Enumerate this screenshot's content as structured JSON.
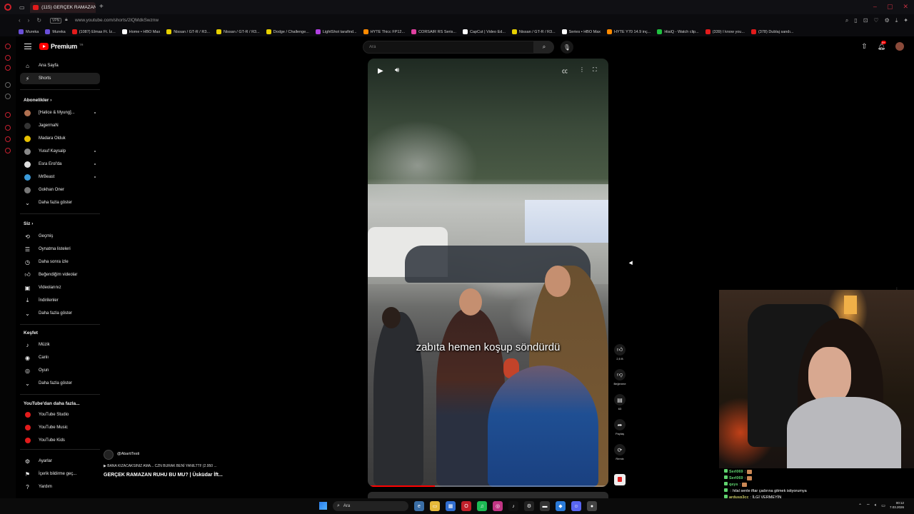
{
  "browser": {
    "tab_title": "(115) GERÇEK RAMAZAN R",
    "url": "www.youtube.com/shorts/2lQMdkSwznw",
    "vpn_label": "VPN",
    "bookmarks": [
      {
        "label": "Mureka",
        "color": "#6a4fd8"
      },
      {
        "label": "Mureka",
        "color": "#6a4fd8"
      },
      {
        "label": "(1087) Elmas Ft. İz...",
        "color": "#e21b1b"
      },
      {
        "label": "Home • HBO Max",
        "color": "#ffffff"
      },
      {
        "label": "Nissan / GT-R / R3...",
        "color": "#e7d000"
      },
      {
        "label": "Nissan / GT-R / R3...",
        "color": "#e7d000"
      },
      {
        "label": "Dodge / Challenge...",
        "color": "#e7d000"
      },
      {
        "label": "LightShot tarafind...",
        "color": "#b040e0"
      },
      {
        "label": "HYTE Thicc FP12...",
        "color": "#ff8a00"
      },
      {
        "label": "CORSAIR RS Seris...",
        "color": "#e040a0"
      },
      {
        "label": "CapCut | Video Ed...",
        "color": "#ffffff"
      },
      {
        "label": "Nissan / GT-R / R3...",
        "color": "#e7d000"
      },
      {
        "label": "Series • HBO Max",
        "color": "#ffffff"
      },
      {
        "label": "HYTE Y70 14.9 inç...",
        "color": "#ff8a00"
      },
      {
        "label": "HiaiQ - Watch clip...",
        "color": "#20c040"
      },
      {
        "label": "(339) I know you...",
        "color": "#e21b1b"
      },
      {
        "label": "(378) Dublaj sandı...",
        "color": "#e21b1b"
      }
    ]
  },
  "youtube": {
    "logo_text": "Premium",
    "logo_tm": "TR",
    "search_placeholder": "Ara",
    "notif_count": "9+",
    "sidebar": {
      "home": "Ana Sayfa",
      "shorts": "Shorts",
      "subs_heading": "Abonelikler",
      "subscriptions": [
        {
          "name": "[Hatice & Myung]...",
          "color": "#b07050"
        },
        {
          "name": "JagermaN",
          "color": "#333333"
        },
        {
          "name": "Madara Olduk",
          "color": "#e7c000"
        },
        {
          "name": "Yusuf Kaysalp",
          "color": "#888888"
        },
        {
          "name": "Esra Erol'da",
          "color": "#dddddd"
        },
        {
          "name": "MrBeast",
          "color": "#3a9ad9"
        },
        {
          "name": "Gokhan Oner",
          "color": "#777777"
        }
      ],
      "show_more_1": "Daha fazla göster",
      "you_heading": "Siz",
      "you_items": [
        "Geçmiş",
        "Oynatma listeleri",
        "Daha sonra izle",
        "Beğendiğim videolar",
        "Videolarınız",
        "İndirilenler"
      ],
      "show_more_2": "Daha fazla göster",
      "explore_heading": "Keşfet",
      "explore_items": [
        "Müzik",
        "Canlı",
        "Oyun"
      ],
      "show_more_3": "Daha fazla göster",
      "more_heading": "YouTube'dan daha fazla...",
      "more_items": [
        "YouTube Studio",
        "YouTube Music",
        "YouTube Kids"
      ],
      "settings_items": [
        "Ayarlar",
        "İçerik bildirme geç...",
        "Yardım"
      ]
    },
    "short": {
      "caption": "zabıta hemen koşup söndürdü",
      "progress": 0.28,
      "channel": "@AbartiTesti",
      "playlist": "BANA KIZACAKSINIZ AMA... CZN BURAK BENİ YANILTTI! (2.950 ...",
      "title": "GERÇEK RAMAZAN RUHU BU MU? | Üsküdar İft...",
      "actions": [
        {
          "icon": "thumbs-up-icon",
          "label": "2,5 B"
        },
        {
          "icon": "thumbs-down-icon",
          "label": "Beğenme"
        },
        {
          "icon": "comment-icon",
          "label": "63"
        },
        {
          "icon": "share-icon",
          "label": "Paylaş"
        },
        {
          "icon": "remix-icon",
          "label": "Remix"
        }
      ]
    }
  },
  "chat": [
    {
      "user": "Serl069",
      "text": ":",
      "cls": "u1"
    },
    {
      "user": "Serl069",
      "text": ":",
      "cls": "u1"
    },
    {
      "user": "qeys",
      "text": ":",
      "cls": "u1"
    },
    {
      "user": "",
      "text": ": hilal senle iftar çadırına gitmek istiyorumya",
      "cls": "u2"
    },
    {
      "user": "ardusp3cc",
      "text": ": İLGİ VERMEYİN",
      "cls": "u3"
    }
  ],
  "taskbar": {
    "search_label": "Ara",
    "time": "00:12",
    "date": "7.03.2026"
  }
}
